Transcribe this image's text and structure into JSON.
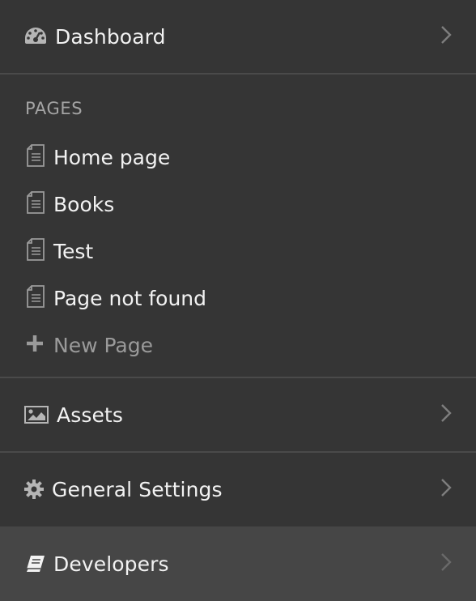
{
  "dashboard": {
    "label": "Dashboard",
    "icon": "dashboard-gauge-icon"
  },
  "pages": {
    "section_title": "PAGES",
    "items": [
      {
        "label": "Home page",
        "icon": "page-icon"
      },
      {
        "label": "Books",
        "icon": "page-icon"
      },
      {
        "label": "Test",
        "icon": "page-icon"
      },
      {
        "label": "Page not found",
        "icon": "page-icon"
      }
    ],
    "new_page": {
      "label": "New Page",
      "icon": "plus-icon"
    }
  },
  "assets": {
    "label": "Assets",
    "icon": "image-icon"
  },
  "general_settings": {
    "label": "General Settings",
    "icon": "gear-icon"
  },
  "developers": {
    "label": "Developers",
    "icon": "book-icon"
  },
  "colors": {
    "background": "#353535",
    "active_background": "#464646",
    "divider": "#4a4a4a",
    "text": "#f2f2f2",
    "muted_text": "#a4a4a4",
    "icon": "#9a9a9a"
  }
}
